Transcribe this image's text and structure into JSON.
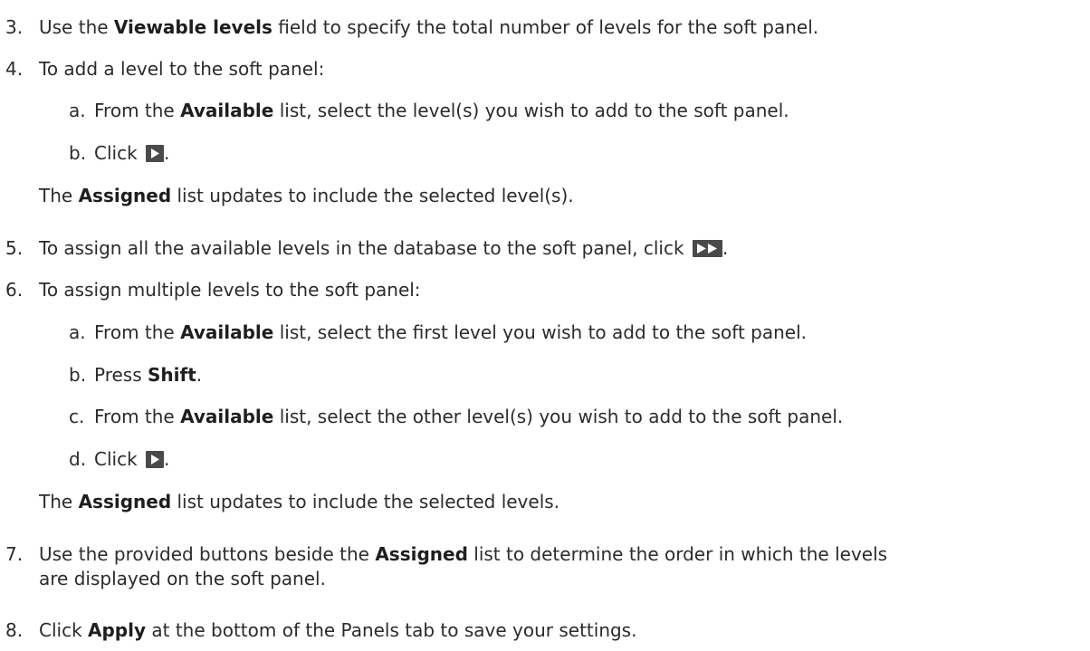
{
  "steps": {
    "s3": {
      "num": "3.",
      "pre": "Use the ",
      "bold": "Viewable levels",
      "post": " field to specify the total number of levels for the soft panel."
    },
    "s4": {
      "num": "4.",
      "text": "To add a level to the soft panel:",
      "a": {
        "label": "a.",
        "pre": "From the ",
        "bold": "Available",
        "post": " list, select the level(s) you wish to add to the soft panel."
      },
      "b": {
        "label": "b.",
        "pre": "Click ",
        "post": "."
      },
      "result": {
        "pre": "The ",
        "bold": "Assigned",
        "post": " list updates to include the selected level(s)."
      }
    },
    "s5": {
      "num": "5.",
      "pre": "To assign all the available levels in the database to the soft panel, click ",
      "post": "."
    },
    "s6": {
      "num": "6.",
      "text": "To assign multiple levels to the soft panel:",
      "a": {
        "label": "a.",
        "pre": "From the ",
        "bold": "Available",
        "post": " list, select the first level you wish to add to the soft panel."
      },
      "b": {
        "label": "b.",
        "pre": "Press ",
        "bold": "Shift",
        "post": "."
      },
      "c": {
        "label": "c.",
        "pre": "From the ",
        "bold": "Available",
        "post": " list, select the other level(s) you wish to add to the soft panel."
      },
      "d": {
        "label": "d.",
        "pre": "Click ",
        "post": "."
      },
      "result": {
        "pre": "The ",
        "bold": "Assigned",
        "post": " list updates to include the selected levels."
      }
    },
    "s7": {
      "num": "7.",
      "pre": "Use the provided buttons beside the ",
      "bold": "Assigned",
      "post": " list to determine the order in which the levels",
      "line2": "are displayed on the soft panel."
    },
    "s8": {
      "num": "8.",
      "pre": "Click ",
      "bold": "Apply",
      "post": " at the bottom of the Panels tab to save your settings."
    }
  },
  "icons": {
    "single_arrow": "play-arrow-icon",
    "double_arrow": "fast-forward-icon",
    "icon_bg": "#4a4a4a"
  }
}
